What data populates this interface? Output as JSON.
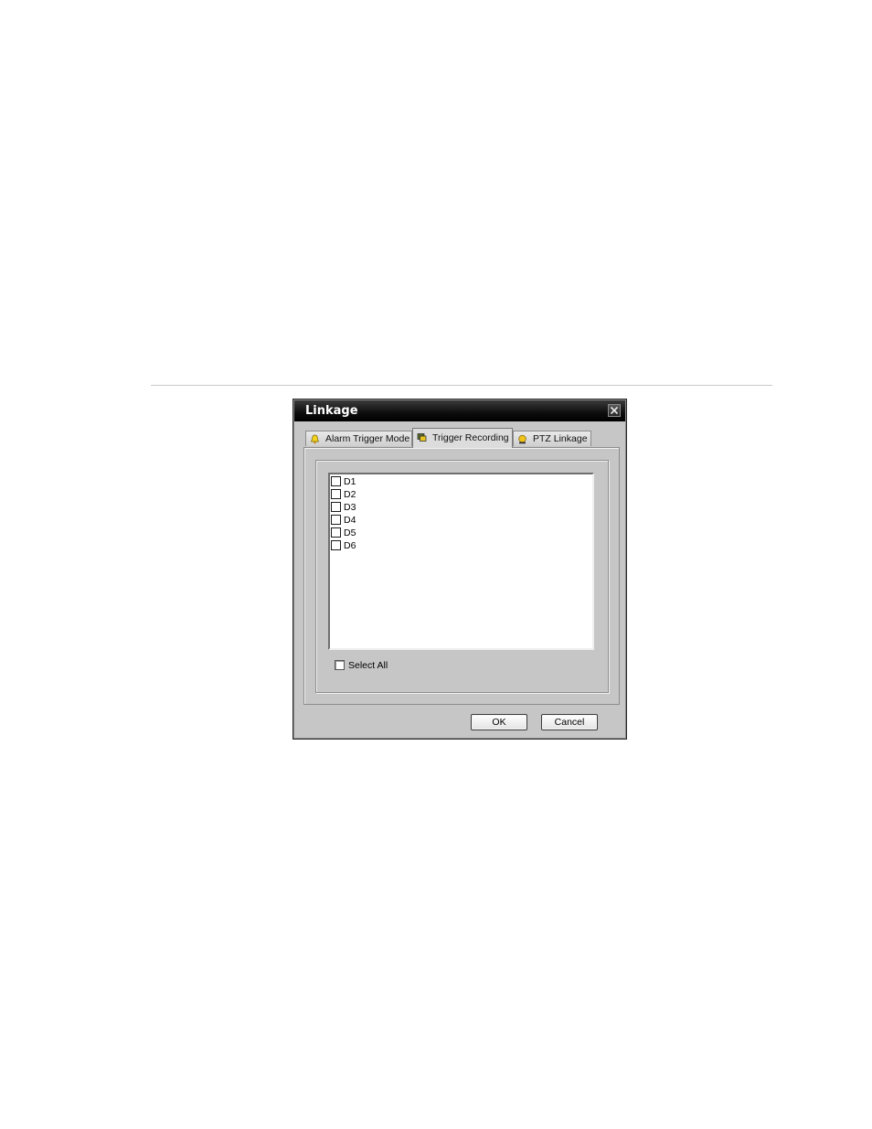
{
  "dialog": {
    "title": "Linkage",
    "close_icon": "close-icon"
  },
  "tabs": [
    {
      "label": "Alarm Trigger Mode",
      "icon": "alarm-bell-icon",
      "active": false
    },
    {
      "label": "Trigger Recording",
      "icon": "recording-icon",
      "active": true
    },
    {
      "label": "PTZ Linkage",
      "icon": "ptz-icon",
      "active": false
    }
  ],
  "channels": [
    {
      "label": "D1",
      "checked": false
    },
    {
      "label": "D2",
      "checked": false
    },
    {
      "label": "D3",
      "checked": false
    },
    {
      "label": "D4",
      "checked": false
    },
    {
      "label": "D5",
      "checked": false
    },
    {
      "label": "D6",
      "checked": false
    }
  ],
  "select_all": {
    "label": "Select All",
    "checked": false
  },
  "buttons": {
    "ok_label": "OK",
    "cancel_label": "Cancel"
  },
  "colors": {
    "titlebar": "#000000",
    "dialog_bg": "#c6c6c6",
    "list_bg": "#ffffff"
  }
}
